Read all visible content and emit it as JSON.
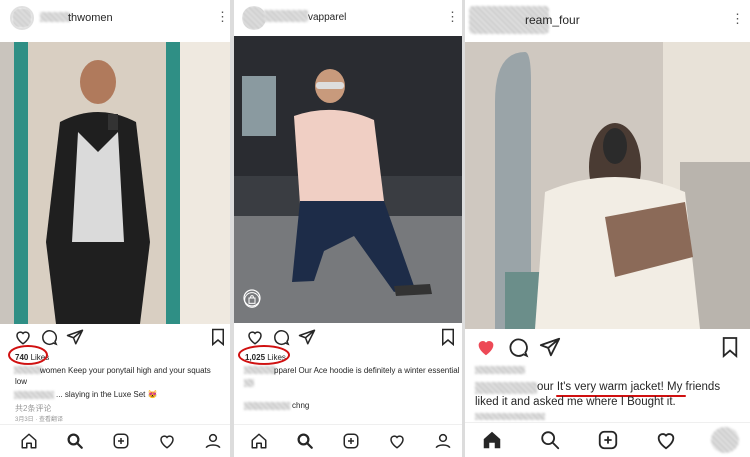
{
  "posts": [
    {
      "username_visible": "thwomen",
      "likes": "740",
      "likes_suffix": " Likes",
      "caption_text": "women Keep your ponytail high and your squats",
      "caption_line2": "low",
      "comment_text": "... slaying in the Luxe Set 😻",
      "comments_link": "共2条评论",
      "time_text": "3月3日 · 查看翻译"
    },
    {
      "username_visible": "vapparel",
      "likes": "1,025",
      "likes_suffix": " Likes",
      "caption_text": "pparel Our Ace hoodie is definitely a winter essential!",
      "comment_text": "chng"
    },
    {
      "username_visible": "ream_four",
      "caption_prefix": "our ",
      "caption_highlight": "It's very warm jacket!",
      "caption_rest": " My friends",
      "caption_line2": "liked it and asked me where I Bought it."
    }
  ],
  "icons": {
    "heart_outline": "heart-icon",
    "heart_filled": "heart-filled-icon",
    "comment": "comment-icon",
    "share": "share-icon",
    "bookmark": "bookmark-icon",
    "more": "more-icon",
    "home": "home-icon",
    "search": "search-icon",
    "add": "add-post-icon",
    "activity": "activity-icon",
    "profile": "profile-icon",
    "shop": "shopping-bag-icon"
  },
  "colors": {
    "annotation_red": "#d01010",
    "like_red": "#ed4956",
    "text": "#262626"
  }
}
